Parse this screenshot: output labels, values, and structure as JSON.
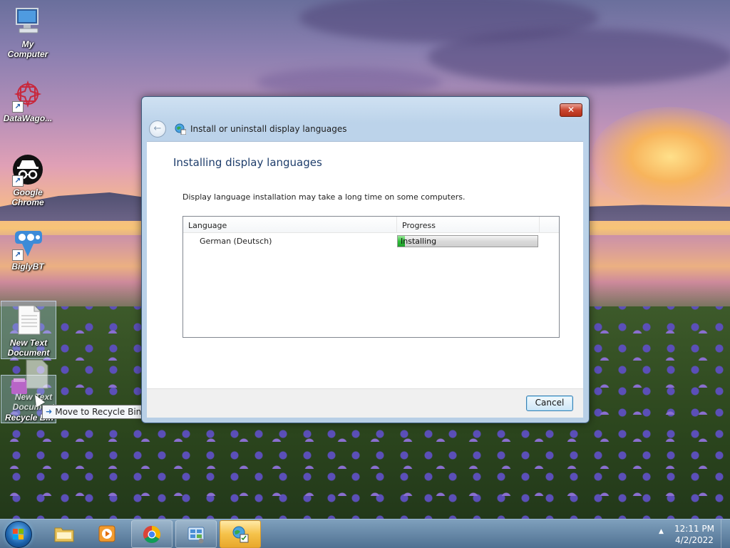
{
  "desktop": {
    "icons": [
      {
        "label": "My\nComputer",
        "icon": "computer-icon"
      },
      {
        "label": "DataWago...",
        "icon": "datawagon-icon"
      },
      {
        "label": "Google Chrome",
        "icon": "incognito-icon"
      },
      {
        "label": "BiglyBT",
        "icon": "biglybt-icon"
      },
      {
        "label": "New Text Document",
        "icon": "text-document-icon"
      },
      {
        "label": "Recycle Bin",
        "icon": "recycle-bin-icon"
      }
    ],
    "drag_label": "New Text Document",
    "tooltip": "Move to Recycle Bin"
  },
  "dialog": {
    "title": "Install or uninstall display languages",
    "close_label": "✕",
    "heading": "Installing display languages",
    "note": "Display language installation may take a long time on some computers.",
    "columns": {
      "language": "Language",
      "progress": "Progress"
    },
    "rows": [
      {
        "language": "German (Deutsch)",
        "status": "Installing",
        "progress": 0.05
      }
    ],
    "cancel_label": "Cancel"
  },
  "taskbar": {
    "buttons": [
      "file-explorer",
      "media-player",
      "chrome",
      "control-panel",
      "language-installer"
    ],
    "active": "language-installer",
    "clock_time": "12:11 PM",
    "clock_date": "4/2/2022"
  },
  "colors": {
    "heading": "#1e3d6b",
    "progress_green": "#2fbf3a",
    "close_red": "#c9452f"
  }
}
